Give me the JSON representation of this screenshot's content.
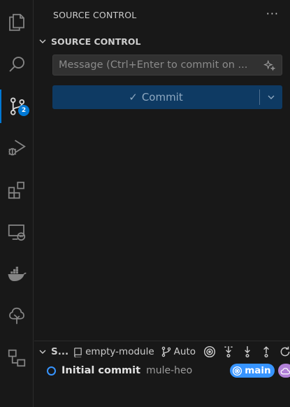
{
  "activity_bar": {
    "items": [
      {
        "name": "explorer-icon"
      },
      {
        "name": "search-icon"
      },
      {
        "name": "source-control-icon",
        "badge": "2",
        "active": true
      },
      {
        "name": "run-debug-icon"
      },
      {
        "name": "extensions-icon"
      },
      {
        "name": "remote-explorer-icon"
      },
      {
        "name": "docker-icon"
      },
      {
        "name": "tree-icon"
      },
      {
        "name": "diagram-icon"
      }
    ],
    "accent": "#0078d4"
  },
  "sidebar": {
    "title": "SOURCE CONTROL",
    "more_label": "···",
    "section_title": "SOURCE CONTROL",
    "message_placeholder": "Message (Ctrl+Enter to commit on ...",
    "commit_label": "Commit",
    "commit_check": "✓"
  },
  "graph": {
    "title": "S...",
    "repo_label": "empty-module",
    "mode_label": "Auto",
    "commits": [
      {
        "message": "Initial commit",
        "author": "mule-heo",
        "branch": "main"
      }
    ],
    "branch_color": "#3794ff",
    "remote_color": "#b180d7"
  }
}
